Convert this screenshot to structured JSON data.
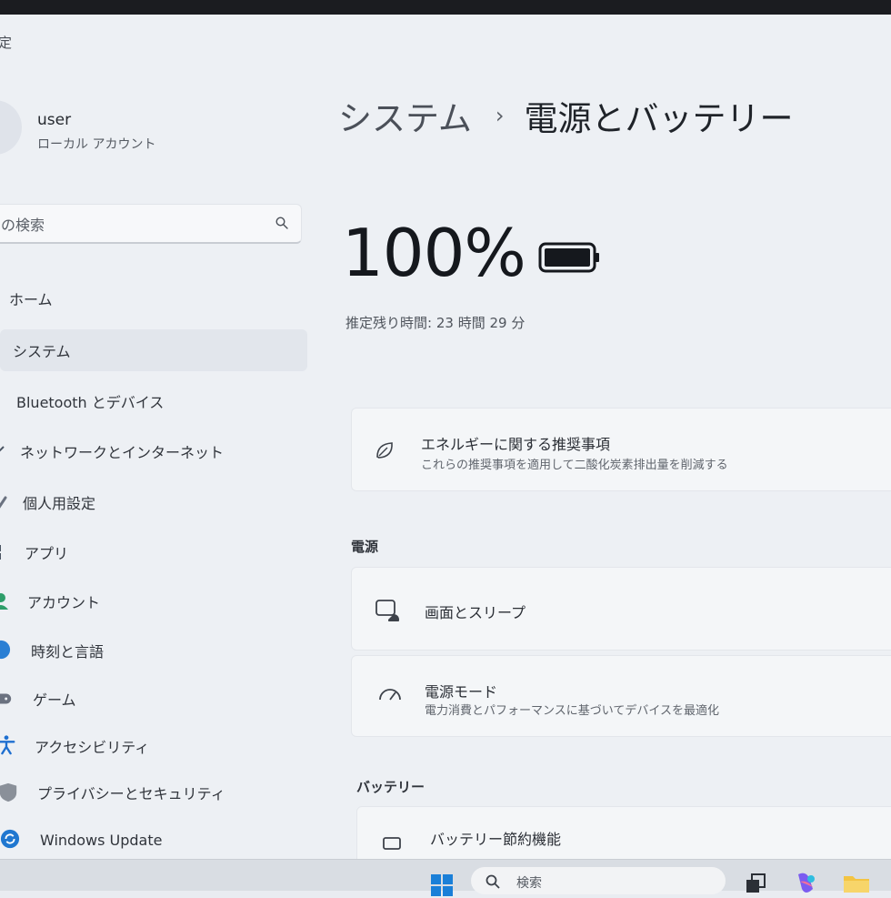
{
  "app": {
    "title": "定"
  },
  "user": {
    "name": "user",
    "account_type": "ローカル アカウント"
  },
  "search": {
    "placeholder": "の検索",
    "icon": "search-icon"
  },
  "sidebar": {
    "items": [
      {
        "label": "ホーム",
        "icon": "home-icon",
        "selected": false
      },
      {
        "label": "システム",
        "icon": "system-icon",
        "selected": true
      },
      {
        "label": "Bluetooth とデバイス",
        "icon": "bluetooth-icon",
        "selected": false
      },
      {
        "label": "ネットワークとインターネット",
        "icon": "network-icon",
        "selected": false
      },
      {
        "label": "個人用設定",
        "icon": "brush-icon",
        "selected": false
      },
      {
        "label": "アプリ",
        "icon": "apps-icon",
        "selected": false
      },
      {
        "label": "アカウント",
        "icon": "account-icon",
        "selected": false
      },
      {
        "label": "時刻と言語",
        "icon": "globe-icon",
        "selected": false
      },
      {
        "label": "ゲーム",
        "icon": "gamepad-icon",
        "selected": false
      },
      {
        "label": "アクセシビリティ",
        "icon": "accessibility-icon",
        "selected": false
      },
      {
        "label": "プライバシーとセキュリティ",
        "icon": "shield-icon",
        "selected": false
      },
      {
        "label": "Windows Update",
        "icon": "update-icon",
        "selected": false
      }
    ]
  },
  "header": {
    "breadcrumb_parent": "システム",
    "breadcrumb_separator": "›",
    "breadcrumb_current": "電源とバッテリー"
  },
  "battery": {
    "percent_text": "100%",
    "level": 1.0,
    "estimate_label": "推定残り時間:",
    "estimate_value": "23 時間 29 分"
  },
  "cards": {
    "energy": {
      "title": "エネルギーに関する推奨事項",
      "subtitle": "これらの推奨事項を適用して二酸化炭素排出量を削減する",
      "icon": "leaf-icon"
    },
    "power_section": "電源",
    "screen_sleep": {
      "title": "画面とスリープ",
      "icon": "screen-sleep-icon"
    },
    "power_mode": {
      "title": "電源モード",
      "subtitle": "電力消費とパフォーマンスに基づいてデバイスを最適化",
      "icon": "gauge-icon"
    },
    "battery_section": "バッテリー",
    "battery_saver": {
      "title": "バッテリー節約機能",
      "icon": "battery-saver-icon"
    }
  },
  "taskbar": {
    "search_text": "検索"
  },
  "colors": {
    "window_bg": "#edf0f4",
    "card_bg": "#f4f6f8",
    "selected_bg": "#e2e6ec",
    "accent": "#0067c0"
  }
}
